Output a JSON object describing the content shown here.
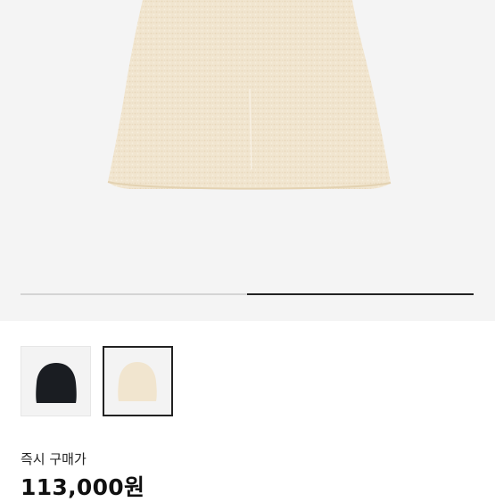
{
  "gallery": {
    "progress_fraction": 0.5,
    "thumbnails": [
      {
        "color": "#1a1d22",
        "selected": false
      },
      {
        "color": "#f1e5cf",
        "selected": true
      }
    ]
  },
  "product": {
    "price_label": "즉시 구매가",
    "price": "113,000원"
  },
  "colors": {
    "hero_bg": "#f4f4f4",
    "beanie_main": "#f1e5cf",
    "beanie_dark": "#1a1d22",
    "track": "#d4d4d4",
    "fill": "#222222"
  }
}
